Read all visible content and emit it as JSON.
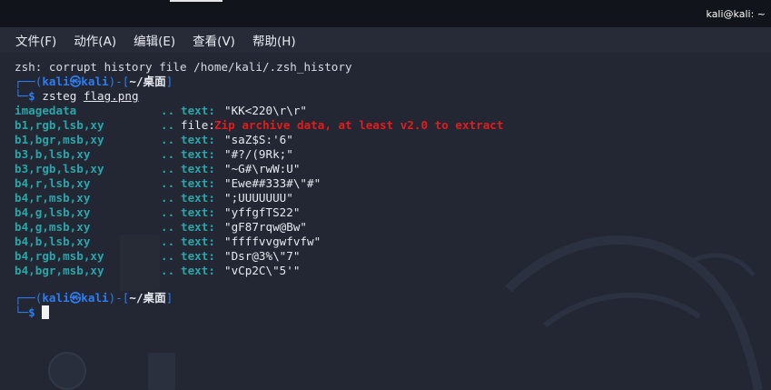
{
  "window": {
    "title": "kali@kali: ~"
  },
  "menu": [
    {
      "label": "文件(F)"
    },
    {
      "label": "动作(A)"
    },
    {
      "label": "编辑(E)"
    },
    {
      "label": "查看(V)"
    },
    {
      "label": "帮助(H)"
    }
  ],
  "terminal": {
    "error_line": "zsh: corrupt history file /home/kali/.zsh_history",
    "prompt1": {
      "open": "┌──(",
      "user": "kali",
      "at_icon": "㉿",
      "host": "kali",
      "mid": ")-[",
      "path": "~/桌面",
      "close": "]",
      "arrow": "└─",
      "symbol": "$",
      "command": "zsteg",
      "argument": "flag.png"
    },
    "results": [
      {
        "label": "imagedata",
        "dots": "..",
        "kind": "text:",
        "value": "\"KK<220\\r\\r\""
      },
      {
        "label": "b1,rgb,lsb,xy",
        "dots": "..",
        "kind": "file:",
        "value": "Zip archive data, at least v2.0 to extract"
      },
      {
        "label": "b1,bgr,msb,xy",
        "dots": "..",
        "kind": "text:",
        "value": "\"saZ$S:'6\""
      },
      {
        "label": "b3,b,lsb,xy",
        "dots": "..",
        "kind": "text:",
        "value": "\"#?/(9Rk;\""
      },
      {
        "label": "b3,rgb,lsb,xy",
        "dots": "..",
        "kind": "text:",
        "value": "\"~G#\\rwW:U\""
      },
      {
        "label": "b4,r,lsb,xy",
        "dots": "..",
        "kind": "text:",
        "value": "\"Ewe##333#\\\"#\""
      },
      {
        "label": "b4,r,msb,xy",
        "dots": "..",
        "kind": "text:",
        "value": "\";UUUUUUU\""
      },
      {
        "label": "b4,g,lsb,xy",
        "dots": "..",
        "kind": "text:",
        "value": "\"yffgfTS22\""
      },
      {
        "label": "b4,g,msb,xy",
        "dots": "..",
        "kind": "text:",
        "value": "\"gF87rqw@Bw\""
      },
      {
        "label": "b4,b,lsb,xy",
        "dots": "..",
        "kind": "text:",
        "value": "\"ffffvvgwfvfw\""
      },
      {
        "label": "b4,rgb,msb,xy",
        "dots": "..",
        "kind": "text:",
        "value": "\"Dsr@3%\\\"7\""
      },
      {
        "label": "b4,bgr,msb,xy",
        "dots": "..",
        "kind": "text:",
        "value": "\"vCp2C\\\"5'\""
      }
    ],
    "prompt2": {
      "open": "┌──(",
      "user": "kali",
      "at_icon": "㉿",
      "host": "kali",
      "mid": ")-[",
      "path": "~/桌面",
      "close": "]",
      "arrow": "└─",
      "symbol": "$"
    },
    "colors": {
      "background": "#222733",
      "prompt_blue": "#2e7cf0",
      "label_teal": "#2aa6a8",
      "file_red": "#e21c1c"
    }
  }
}
